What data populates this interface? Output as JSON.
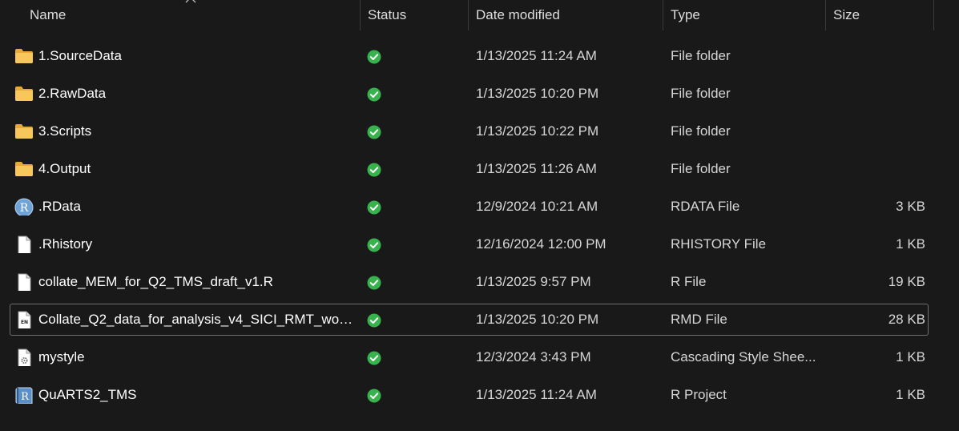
{
  "header": {
    "name": "Name",
    "status": "Status",
    "date_modified": "Date modified",
    "type": "Type",
    "size": "Size"
  },
  "files": [
    {
      "name": "1.SourceData",
      "icon": "folder-icon",
      "status": "synced-icon",
      "date": "1/13/2025 11:24 AM",
      "type": "File folder",
      "size": ""
    },
    {
      "name": "2.RawData",
      "icon": "folder-icon",
      "status": "synced-icon",
      "date": "1/13/2025 10:20 PM",
      "type": "File folder",
      "size": ""
    },
    {
      "name": "3.Scripts",
      "icon": "folder-icon",
      "status": "synced-icon",
      "date": "1/13/2025 10:22 PM",
      "type": "File folder",
      "size": ""
    },
    {
      "name": "4.Output",
      "icon": "folder-icon",
      "status": "synced-icon",
      "date": "1/13/2025 11:26 AM",
      "type": "File folder",
      "size": ""
    },
    {
      "name": ".RData",
      "icon": "r-data-icon",
      "status": "synced-icon",
      "date": "12/9/2024 10:21 AM",
      "type": "RDATA File",
      "size": "3 KB"
    },
    {
      "name": ".Rhistory",
      "icon": "blank-file-icon",
      "status": "synced-icon",
      "date": "12/16/2024 12:00 PM",
      "type": "RHISTORY File",
      "size": "1 KB"
    },
    {
      "name": "collate_MEM_for_Q2_TMS_draft_v1.R",
      "icon": "blank-file-icon",
      "status": "synced-icon",
      "date": "1/13/2025 9:57 PM",
      "type": "R File",
      "size": "19 KB"
    },
    {
      "name": "Collate_Q2_data_for_analysis_v4_SICI_RMT_work...",
      "icon": "rmd-file-icon",
      "status": "synced-icon",
      "date": "1/13/2025 10:20 PM",
      "type": "RMD File",
      "size": "28 KB",
      "selected": true
    },
    {
      "name": "mystyle",
      "icon": "css-file-icon",
      "status": "synced-icon",
      "date": "12/3/2024 3:43 PM",
      "type": "Cascading Style Shee...",
      "size": "1 KB"
    },
    {
      "name": "QuARTS2_TMS",
      "icon": "r-project-icon",
      "status": "synced-icon",
      "date": "1/13/2025 11:24 AM",
      "type": "R Project",
      "size": "1 KB"
    }
  ],
  "colors": {
    "background": "#191919",
    "folder": "#f5c04e",
    "synced": "#37b24d",
    "r_blue": "#6fa3d8"
  }
}
